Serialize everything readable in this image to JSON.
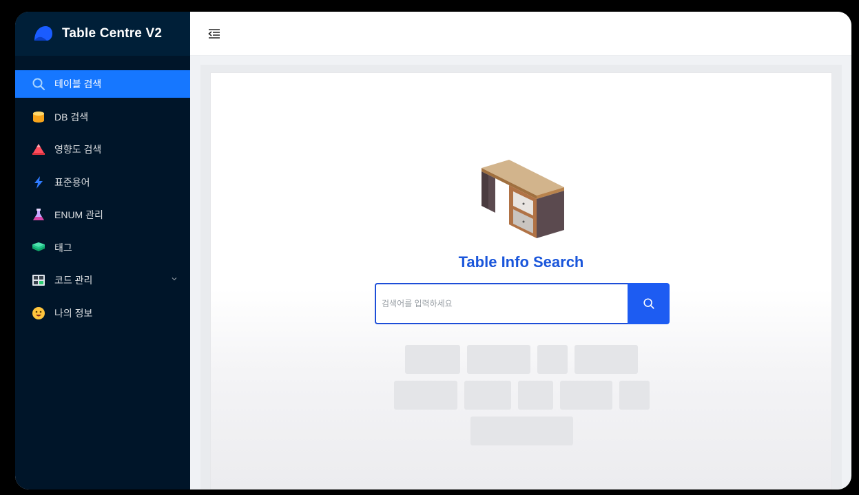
{
  "brand": {
    "title": "Table Centre V2"
  },
  "sidebar": {
    "items": [
      {
        "label": "테이블 검색",
        "icon": "search-icon",
        "active": true
      },
      {
        "label": "DB 검색",
        "icon": "database-icon"
      },
      {
        "label": "영향도 검색",
        "icon": "impact-icon"
      },
      {
        "label": "표준용어",
        "icon": "lightning-icon"
      },
      {
        "label": "ENUM 관리",
        "icon": "flask-icon"
      },
      {
        "label": "태그",
        "icon": "layers-icon"
      },
      {
        "label": "코드 관리",
        "icon": "code-board-icon",
        "has_submenu": true
      },
      {
        "label": "나의 정보",
        "icon": "smiley-icon"
      }
    ]
  },
  "main": {
    "title": "Table Info Search",
    "search": {
      "placeholder": "검색어를 입력하세요",
      "value": ""
    }
  },
  "colors": {
    "sidebar_bg": "#001529",
    "active_item": "#1677ff",
    "title_blue": "#1a56db",
    "search_button": "#1d5cf2"
  }
}
